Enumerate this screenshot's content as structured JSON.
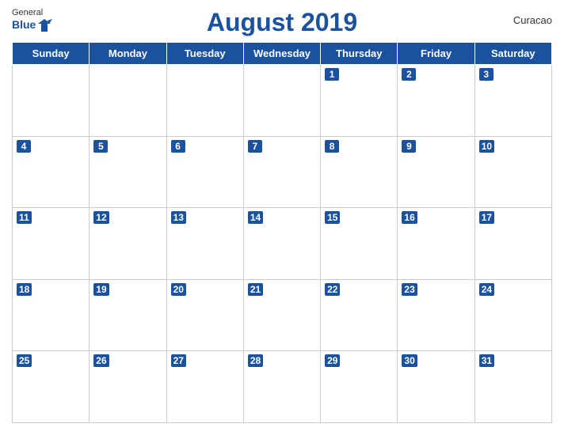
{
  "header": {
    "logo_general": "General",
    "logo_blue": "Blue",
    "title": "August 2019",
    "region": "Curacao"
  },
  "days_of_week": [
    "Sunday",
    "Monday",
    "Tuesday",
    "Wednesday",
    "Thursday",
    "Friday",
    "Saturday"
  ],
  "weeks": [
    [
      null,
      null,
      null,
      null,
      1,
      2,
      3
    ],
    [
      4,
      5,
      6,
      7,
      8,
      9,
      10
    ],
    [
      11,
      12,
      13,
      14,
      15,
      16,
      17
    ],
    [
      18,
      19,
      20,
      21,
      22,
      23,
      24
    ],
    [
      25,
      26,
      27,
      28,
      29,
      30,
      31
    ]
  ]
}
